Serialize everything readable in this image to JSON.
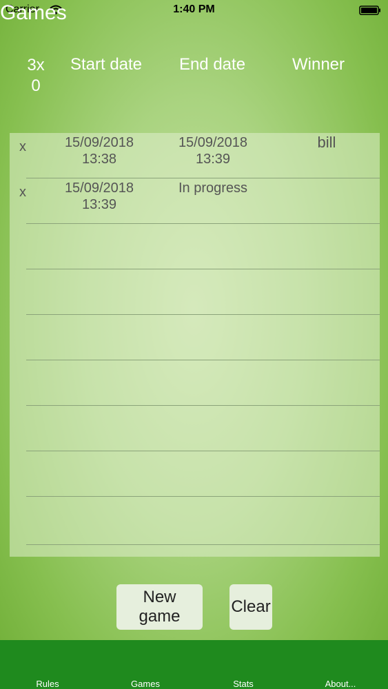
{
  "status": {
    "carrier": "Carrier",
    "time": "1:40 PM"
  },
  "title": "Games",
  "header": {
    "count": "3x",
    "count_sub": "0",
    "start_date": "Start date",
    "end_date": "End date",
    "winner": "Winner"
  },
  "rows": [
    {
      "x": "x",
      "start_date": "15/09/2018",
      "start_time": "13:38",
      "end_date": "15/09/2018",
      "end_time": "13:39",
      "winner": "bill"
    },
    {
      "x": "x",
      "start_date": "15/09/2018",
      "start_time": "13:39",
      "end_date": "In progress",
      "end_time": "",
      "winner": ""
    }
  ],
  "buttons": {
    "new_game": "New game",
    "clear": "Clear"
  },
  "tabs": [
    "Rules",
    "Games",
    "Stats",
    "About..."
  ]
}
